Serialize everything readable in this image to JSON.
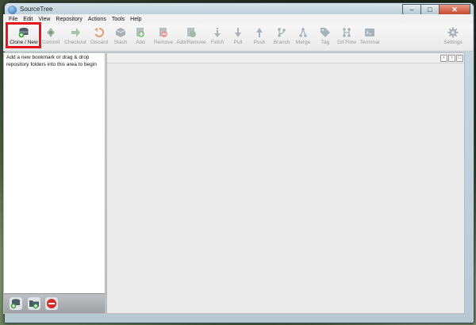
{
  "window": {
    "title": "SourceTree"
  },
  "window_controls": {
    "minimize": "–",
    "maximize": "□",
    "close": "✕"
  },
  "menu": [
    "File",
    "Edit",
    "View",
    "Repository",
    "Actions",
    "Tools",
    "Help"
  ],
  "toolbar": [
    {
      "label": "Clone / New",
      "icon": "clone-new-icon",
      "enabled": true
    },
    {
      "label": "Commit",
      "icon": "commit-icon",
      "enabled": false
    },
    {
      "label": "Checkout",
      "icon": "checkout-icon",
      "enabled": false
    },
    {
      "label": "Discard",
      "icon": "discard-icon",
      "enabled": false
    },
    {
      "label": "Stash",
      "icon": "stash-icon",
      "enabled": false
    },
    {
      "label": "Add",
      "icon": "add-icon",
      "enabled": false
    },
    {
      "label": "Remove",
      "icon": "remove-icon",
      "enabled": false
    },
    {
      "label": "Add/Remove",
      "icon": "add-remove-icon",
      "enabled": false
    },
    {
      "label": "Fetch",
      "icon": "fetch-icon",
      "enabled": false
    },
    {
      "label": "Pull",
      "icon": "pull-icon",
      "enabled": false
    },
    {
      "label": "Push",
      "icon": "push-icon",
      "enabled": false
    },
    {
      "label": "Branch",
      "icon": "branch-icon",
      "enabled": false
    },
    {
      "label": "Merge",
      "icon": "merge-icon",
      "enabled": false
    },
    {
      "label": "Tag",
      "icon": "tag-icon",
      "enabled": false
    },
    {
      "label": "Git Flow",
      "icon": "git-flow-icon",
      "enabled": false
    },
    {
      "label": "Terminal",
      "icon": "terminal-icon",
      "enabled": false
    },
    {
      "label": "Settings",
      "icon": "gear-icon",
      "enabled": false
    }
  ],
  "sidebar": {
    "hint": "Add a new bookmark or drag & drop repository folders into this area to begin",
    "footer_buttons": [
      "add-repository-icon",
      "add-folder-icon",
      "remove-icon"
    ]
  },
  "content": {
    "nav": [
      "‹",
      "›",
      "□"
    ]
  },
  "colors": {
    "highlight": "#e8141b",
    "disabled_text": "#9a9a9a"
  }
}
